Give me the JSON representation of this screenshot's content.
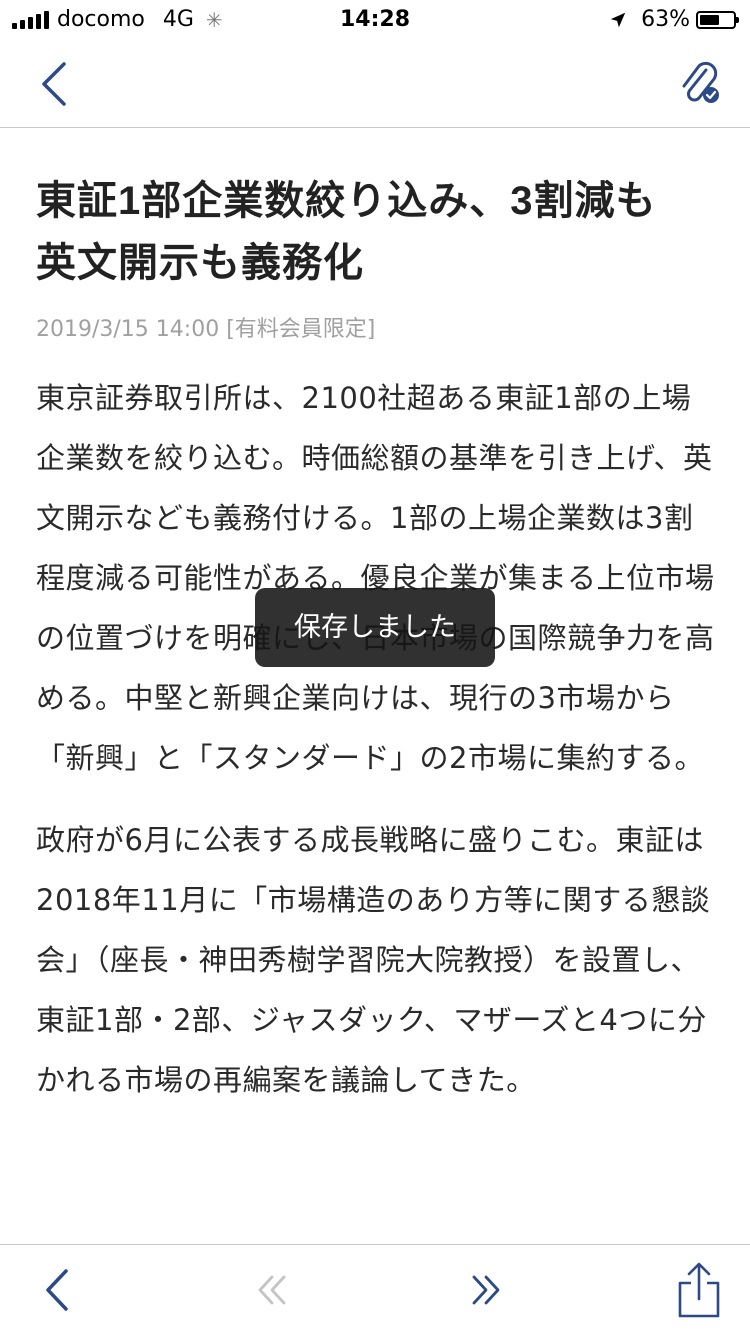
{
  "status_bar": {
    "carrier": "docomo",
    "network": "4G",
    "time": "14:28",
    "battery": "63%",
    "battery_level": 0.63
  },
  "nav_bar": {
    "back_icon": "chevron-left-icon",
    "clip_icon": "paperclip-check-icon",
    "accent_color": "#2c4a86"
  },
  "article": {
    "title": "東証1部企業数絞り込み、3割減も　英文開示も義務化",
    "meta": "2019/3/15 14:00 [有料会員限定]",
    "paragraphs": [
      "東京証券取引所は、2100社超ある東証1部の上場企業数を絞り込む。時価総額の基準を引き上げ、英文開示なども義務付ける。1部の上場企業数は3割程度減る可能性がある。優良企業が集まる上位市場の位置づけを明確にし、日本市場の国際競争力を高める。中堅と新興企業向けは、現行の3市場から「新興」と「スタンダード」の2市場に集約する。",
      "政府が6月に公表する成長戦略に盛りこむ。東証は2018年11月に「市場構造のあり方等に関する懇談会」（座長・神田秀樹学習院大院教授）を設置し、東証1部・2部、ジャスダック、マザーズと4つに分かれる市場の再編案を議論してきた。"
    ]
  },
  "toast": {
    "message": "保存しました"
  },
  "toolbar": {
    "back_icon": "chevron-left-icon",
    "prev_icon": "double-chevron-left-icon",
    "next_icon": "double-chevron-right-icon",
    "share_icon": "share-icon"
  }
}
